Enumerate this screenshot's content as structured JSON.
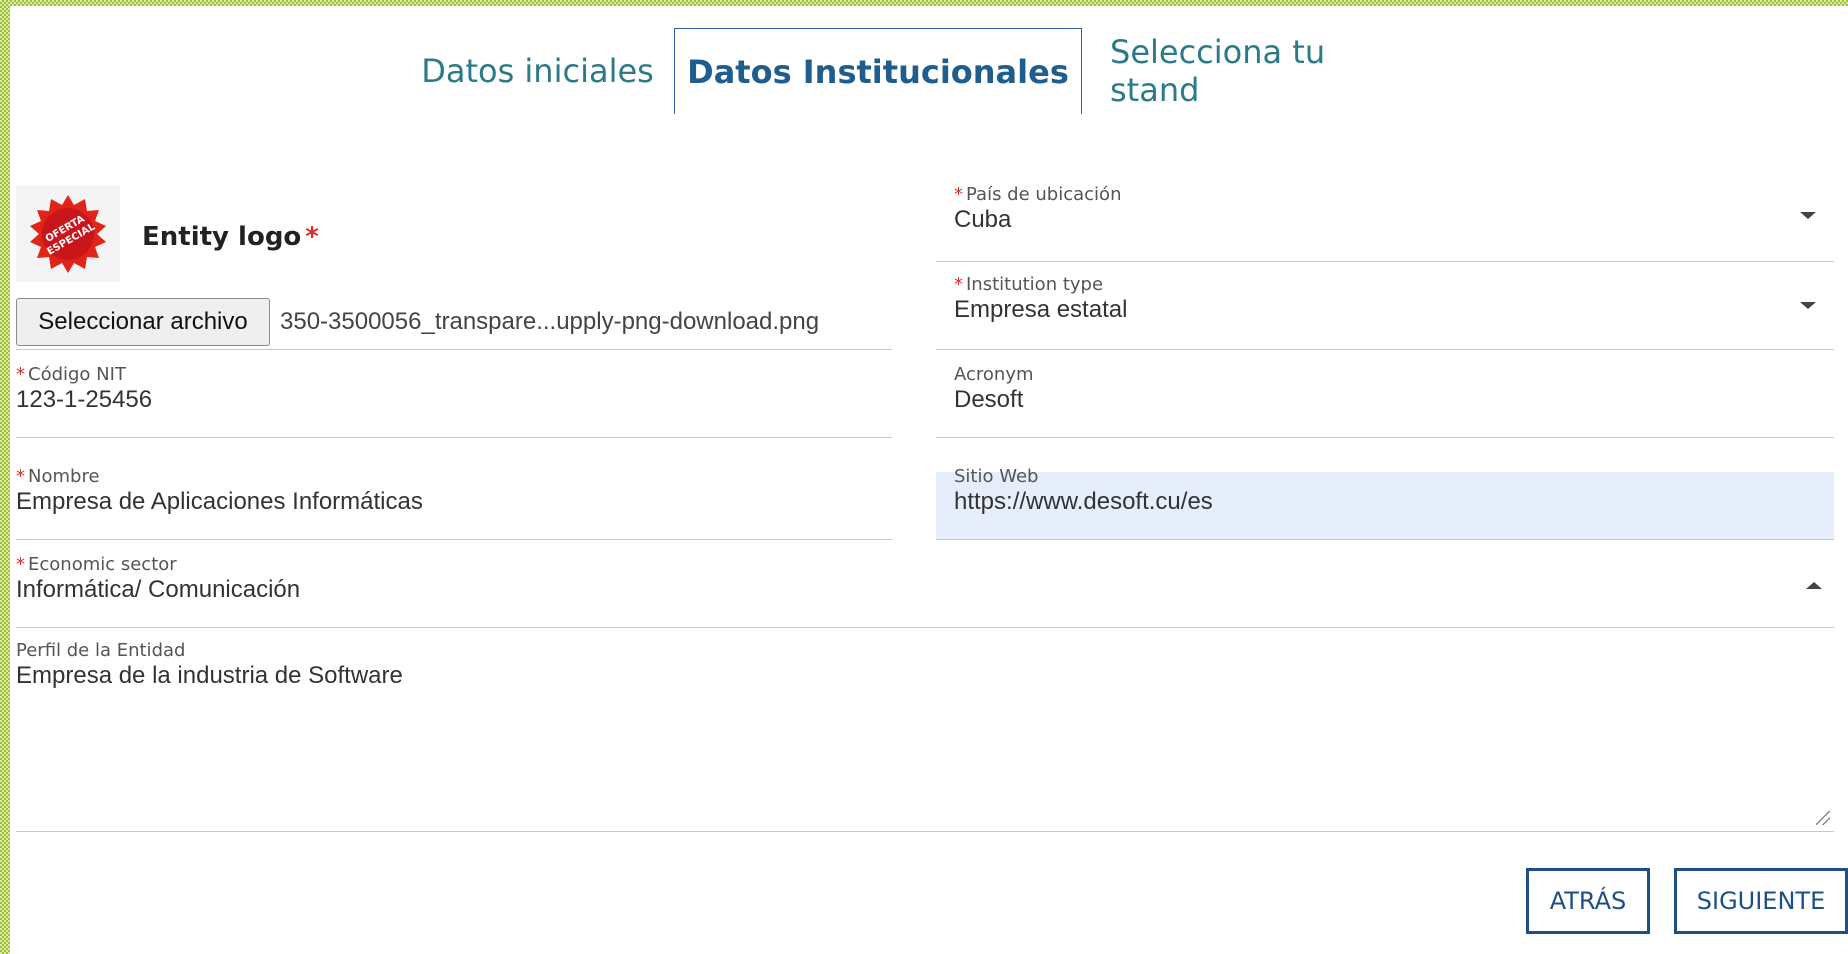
{
  "tabs": [
    {
      "label": "Datos iniciales",
      "active": false
    },
    {
      "label": "Datos Institucionales",
      "active": true
    },
    {
      "label": "Selecciona tu stand",
      "active": false
    }
  ],
  "logo": {
    "label": "Entity logo",
    "required_mark": "*",
    "badge_lettering": "OFERTA ESPECIAL",
    "file_button": "Seleccionar archivo",
    "file_name": "350-3500056_transpare...upply-png-download.png"
  },
  "fields": {
    "pais": {
      "label": "País de ubicación",
      "value": "Cuba",
      "required": "*"
    },
    "institution_type": {
      "label": "Institution type",
      "value": "Empresa estatal",
      "required": "*"
    },
    "nit": {
      "label": "Código NIT",
      "value": "123-1-25456",
      "required": "*"
    },
    "acronym": {
      "label": "Acronym",
      "value": "Desoft"
    },
    "nombre": {
      "label": "Nombre",
      "value": "Empresa de Aplicaciones Informáticas",
      "required": "*"
    },
    "sitio_web": {
      "label": "Sitio Web",
      "value": "https://www.desoft.cu/es"
    },
    "economic_sector": {
      "label": "Economic sector",
      "value": "Informática/ Comunicación",
      "required": "*"
    },
    "perfil": {
      "label": "Perfil de la Entidad",
      "value": "Empresa de la industria de Software"
    }
  },
  "buttons": {
    "back": "ATRÁS",
    "next": "SIGUIENTE"
  },
  "colors": {
    "accent": "#1f4f86",
    "tab_text": "#2b7a88",
    "required": "#d32f2f"
  }
}
